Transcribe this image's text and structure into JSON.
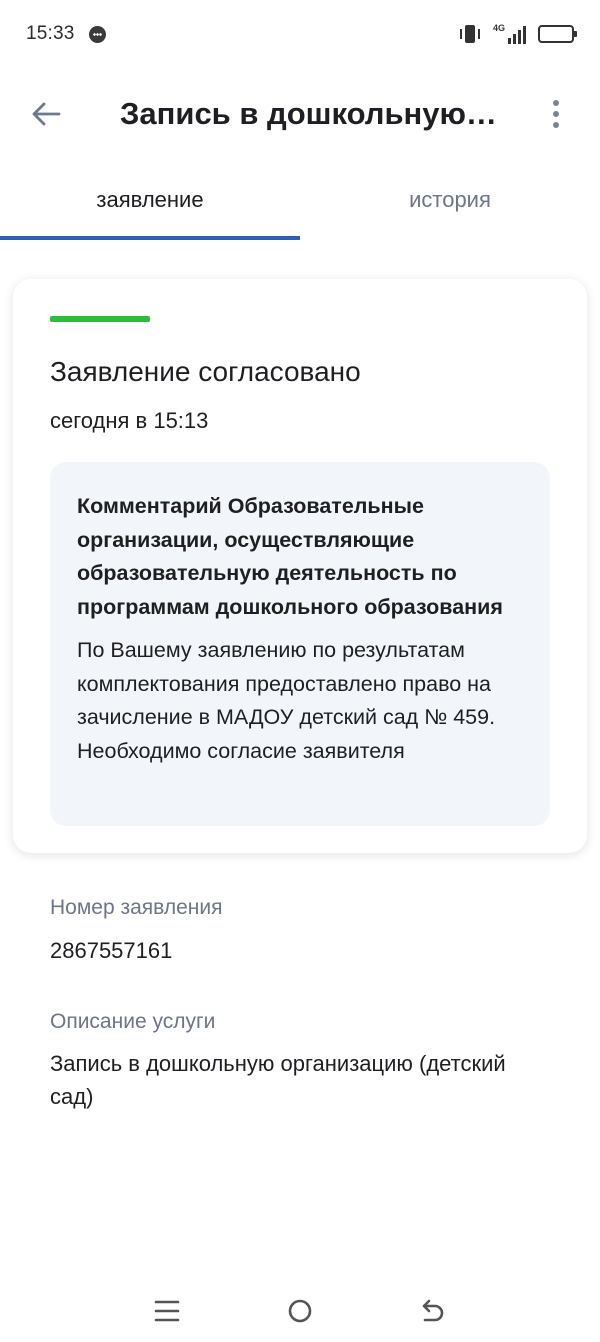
{
  "status_bar": {
    "time": "15:33",
    "network_label": "4G",
    "icons": [
      "message-icon",
      "vibrate-icon",
      "signal-icon",
      "battery-icon"
    ]
  },
  "app_bar": {
    "title": "Запись в дошкольную…",
    "back_icon": "arrow-left-icon",
    "menu_icon": "more-vert-icon"
  },
  "tabs": [
    {
      "label": "заявление",
      "active": true
    },
    {
      "label": "история",
      "active": false
    }
  ],
  "status_card": {
    "title": "Заявление согласовано",
    "date": "сегодня в 15:13",
    "status_color": "#2dbd3b",
    "comment": {
      "title": "Комментарий Образовательные организации, осуществляющие образовательную деятельность по программам дошкольного образования",
      "text": "По Вашему заявлению по результатам комплектования предоставлено право на зачисление в МАДОУ детский сад № 459. Необходимо согласие заявителя"
    }
  },
  "fields": {
    "application_number": {
      "label": "Номер заявления",
      "value": "2867557161"
    },
    "service_description": {
      "label": "Описание услуги",
      "value": "Запись в дошкольную организацию (детский сад)"
    }
  },
  "nav_bar": {
    "icons": [
      "menu-icon",
      "home-icon",
      "back-icon"
    ]
  },
  "colors": {
    "accent": "#2f5fb3",
    "text": "#1f1f23",
    "muted": "#6c7686",
    "comment_bg": "#f2f5f9",
    "success": "#2dbd3b"
  }
}
